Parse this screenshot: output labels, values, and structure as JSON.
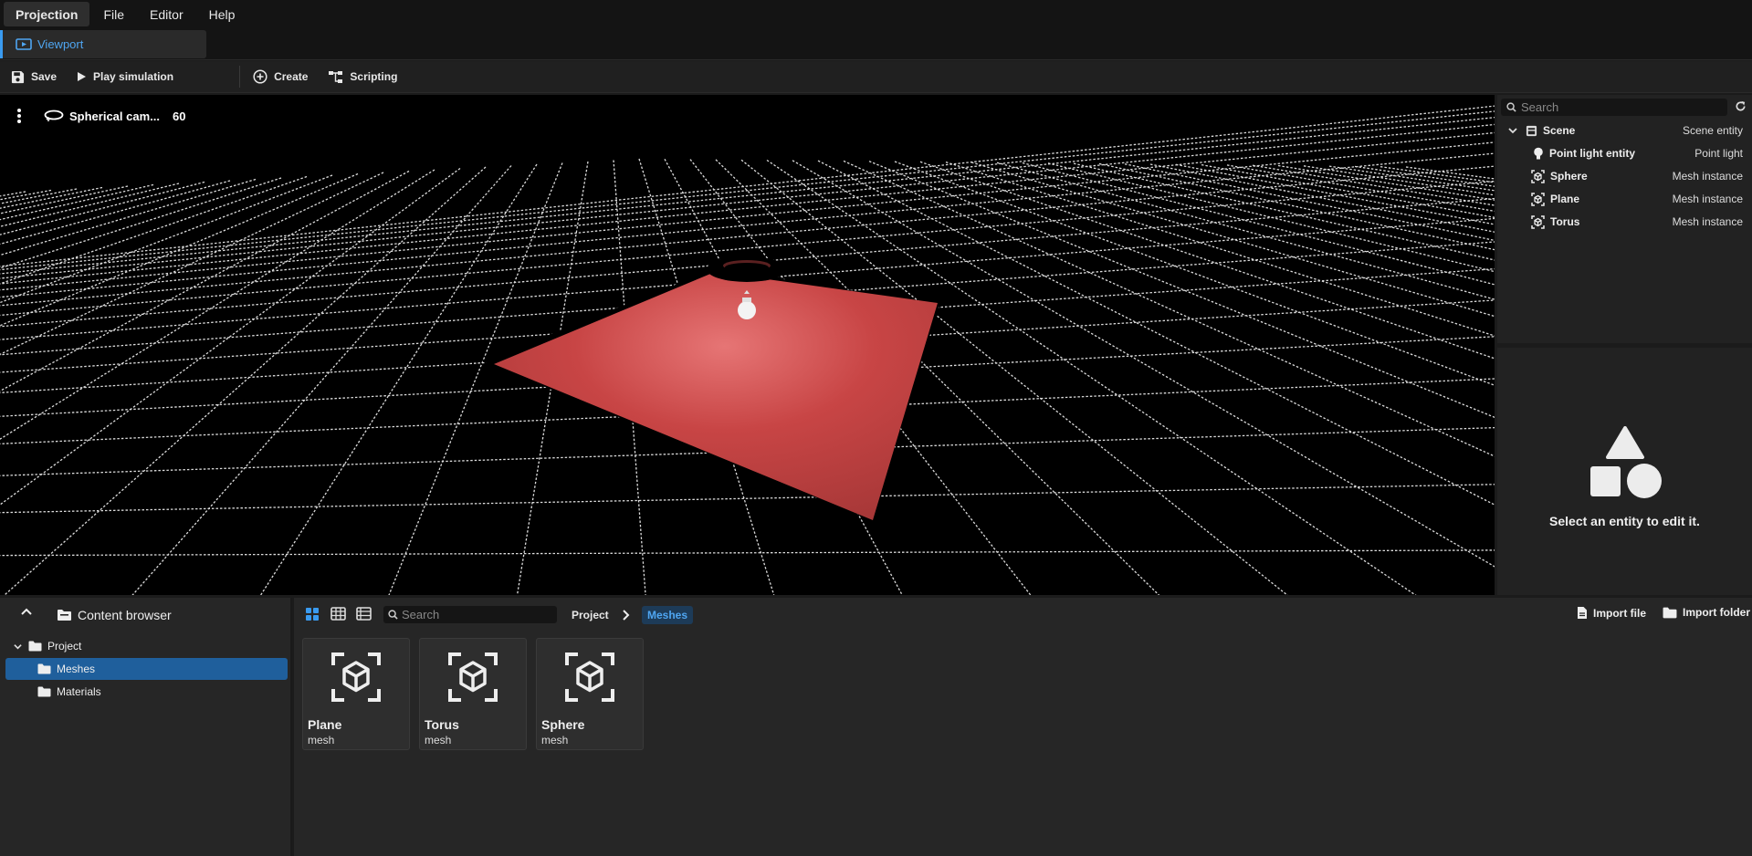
{
  "menubar": {
    "items": [
      {
        "label": "Projection",
        "active": true
      },
      {
        "label": "File"
      },
      {
        "label": "Editor"
      },
      {
        "label": "Help"
      }
    ]
  },
  "tabs": [
    {
      "label": "Viewport",
      "icon": "viewport-icon"
    }
  ],
  "toolbar": {
    "save_label": "Save",
    "play_label": "Play simulation",
    "create_label": "Create",
    "scripting_label": "Scripting"
  },
  "viewport": {
    "camera_label": "Spherical cam...",
    "fov_value": "60"
  },
  "outliner": {
    "search_placeholder": "Search",
    "rows": [
      {
        "name": "Scene",
        "type": "Scene entity",
        "icon": "scene-icon"
      },
      {
        "name": "Point light entity",
        "type": "Point light",
        "icon": "light-bulb-icon"
      },
      {
        "name": "Sphere",
        "type": "Mesh instance",
        "icon": "mesh-instance-icon"
      },
      {
        "name": "Plane",
        "type": "Mesh instance",
        "icon": "mesh-instance-icon"
      },
      {
        "name": "Torus",
        "type": "Mesh instance",
        "icon": "mesh-instance-icon"
      }
    ]
  },
  "inspector": {
    "empty_message": "Select an entity to edit it."
  },
  "content_browser": {
    "title": "Content browser",
    "tree": [
      {
        "label": "Project"
      },
      {
        "label": "Meshes",
        "selected": true
      },
      {
        "label": "Materials"
      }
    ],
    "search_placeholder": "Search",
    "breadcrumb": [
      "Project",
      "Meshes"
    ],
    "import_file_label": "Import file",
    "import_folder_label": "Import folder",
    "assets": [
      {
        "name": "Plane",
        "kind": "mesh"
      },
      {
        "name": "Torus",
        "kind": "mesh"
      },
      {
        "name": "Sphere",
        "kind": "mesh"
      }
    ]
  },
  "colors": {
    "accent": "#3a9bf0",
    "selection": "#1f5f9c",
    "plane": "#c94a4a"
  }
}
